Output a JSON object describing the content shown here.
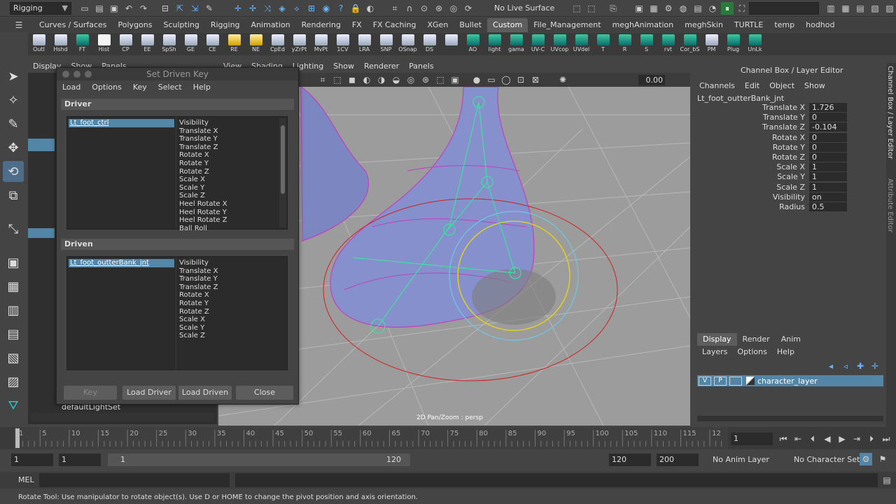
{
  "topbar": {
    "mode": "Rigging",
    "live_surface": "No Live Surface"
  },
  "shelf_tabs": [
    "Curves / Surfaces",
    "Polygons",
    "Sculpting",
    "Rigging",
    "Animation",
    "Rendering",
    "FX",
    "FX Caching",
    "XGen",
    "Bullet",
    "Custom",
    "File_Management",
    "meghAnimation",
    "meghSkin",
    "TURTLE",
    "temp",
    "hodhod"
  ],
  "shelf_active": "Custom",
  "shelf_items": [
    {
      "label": "Outl",
      "icon": "outliner-icon"
    },
    {
      "label": "Hshd",
      "icon": "hypershade-icon"
    },
    {
      "label": "FT",
      "icon": "freeze-transform-icon"
    },
    {
      "label": "Hist",
      "icon": "delete-history-icon"
    },
    {
      "label": "CP",
      "icon": "center-pivot-icon"
    },
    {
      "label": "EE",
      "icon": "editor-icon"
    },
    {
      "label": "SpSh",
      "icon": "spreadsheet-icon"
    },
    {
      "label": "GE",
      "icon": "graph-editor-icon"
    },
    {
      "label": "CE",
      "icon": "component-editor-icon"
    },
    {
      "label": "RE",
      "icon": "render-editor-icon"
    },
    {
      "label": "NE",
      "icon": "node-editor-icon"
    },
    {
      "label": "CpEd",
      "icon": "copy-edit-icon"
    },
    {
      "label": "yZrPt",
      "icon": "zero-pivot-icon"
    },
    {
      "label": "MvPt",
      "icon": "move-pivot-icon"
    },
    {
      "label": "1CV",
      "icon": "curve-icon"
    },
    {
      "label": "LRA",
      "icon": "local-axis-icon"
    },
    {
      "label": "SNP",
      "icon": "snap-icon"
    },
    {
      "label": "OSnap",
      "icon": "object-snap-icon"
    },
    {
      "label": "DS",
      "icon": "display-smooth-icon"
    },
    {
      "label": "",
      "icon": "grid-icon"
    },
    {
      "label": "AO",
      "icon": "ambient-occlusion-icon"
    },
    {
      "label": "light",
      "icon": "light-icon"
    },
    {
      "label": "gama",
      "icon": "gamma-icon"
    },
    {
      "label": "UV-C",
      "icon": "uv-copy-icon"
    },
    {
      "label": "UVcop",
      "icon": "uv-copy2-icon"
    },
    {
      "label": "UVdel",
      "icon": "uv-delete-icon"
    },
    {
      "label": "T",
      "icon": "translate-icon"
    },
    {
      "label": "R",
      "icon": "rotate-icon"
    },
    {
      "label": "S",
      "icon": "scale-icon"
    },
    {
      "label": "rvt",
      "icon": "revert-icon"
    },
    {
      "label": "Cor_bS",
      "icon": "corrective-blendshape-icon"
    },
    {
      "label": "PM",
      "icon": "pm-icon"
    },
    {
      "label": "Plug",
      "icon": "plugin-icon"
    },
    {
      "label": "UnLk",
      "icon": "unlock-icon"
    }
  ],
  "outliner": {
    "menu": [
      "Display",
      "Show",
      "Panels"
    ],
    "last_item": "defaultLightSet"
  },
  "viewport": {
    "menu": [
      "View",
      "Shading",
      "Lighting",
      "Show",
      "Renderer",
      "Panels"
    ],
    "zoom": "0.00",
    "status": "2D Pan/Zoom : persp"
  },
  "sdk": {
    "title": "Set Driven Key",
    "menu": [
      "Load",
      "Options",
      "Key",
      "Select",
      "Help"
    ],
    "driver_label": "Driver",
    "driver_object": "Lt_foot_ctrl",
    "driver_attrs": [
      "Visibility",
      "Translate X",
      "Translate Y",
      "Translate Z",
      "Rotate X",
      "Rotate Y",
      "Rotate Z",
      "Scale X",
      "Scale Y",
      "Scale Z",
      "Heel Rotate X",
      "Heel Rotate Y",
      "Heel Rotate Z",
      "Ball Roll"
    ],
    "driven_label": "Driven",
    "driven_object": "Lt_foot_outterBank_jnt",
    "driven_attrs": [
      "Visibility",
      "Translate X",
      "Translate Y",
      "Translate Z",
      "Rotate X",
      "Rotate Y",
      "Rotate Z",
      "Scale X",
      "Scale Y",
      "Scale Z"
    ],
    "buttons": {
      "key": "Key",
      "load_driver": "Load Driver",
      "load_driven": "Load Driven",
      "close": "Close"
    }
  },
  "channel_box": {
    "title": "Channel Box / Layer Editor",
    "menu": [
      "Channels",
      "Edit",
      "Object",
      "Show"
    ],
    "object": "Lt_foot_outterBank_jnt",
    "channels": [
      {
        "name": "Translate X",
        "value": "1.726"
      },
      {
        "name": "Translate Y",
        "value": "0"
      },
      {
        "name": "Translate Z",
        "value": "-0.104"
      },
      {
        "name": "Rotate X",
        "value": "0"
      },
      {
        "name": "Rotate Y",
        "value": "0"
      },
      {
        "name": "Rotate Z",
        "value": "0"
      },
      {
        "name": "Scale X",
        "value": "1"
      },
      {
        "name": "Scale Y",
        "value": "1"
      },
      {
        "name": "Scale Z",
        "value": "1"
      },
      {
        "name": "Visibility",
        "value": "on"
      },
      {
        "name": "Radius",
        "value": "0.5"
      }
    ]
  },
  "layer_editor": {
    "tabs": [
      "Display",
      "Render",
      "Anim"
    ],
    "menu": [
      "Layers",
      "Options",
      "Help"
    ],
    "layer": {
      "v": "V",
      "p": "P",
      "name": "character_layer"
    }
  },
  "side_tabs": [
    "Channel Box / Layer Editor",
    "Attribute Editor"
  ],
  "timeline": {
    "ticks": [
      "1",
      "5",
      "10",
      "15",
      "20",
      "25",
      "30",
      "35",
      "40",
      "45",
      "50",
      "55",
      "60",
      "65",
      "70",
      "75",
      "80",
      "85",
      "90",
      "95",
      "100",
      "105",
      "110",
      "115",
      "12"
    ],
    "current_frame": "1"
  },
  "range": {
    "start": "1",
    "playback_start": "1",
    "slider_start": "1",
    "slider_end": "120",
    "playback_end": "120",
    "end": "200",
    "anim_layer": "No Anim Layer",
    "char_set": "No Character Set"
  },
  "cmd": {
    "label": "MEL"
  },
  "help_line": "Rotate Tool: Use manipulator to rotate object(s). Use D or HOME to change the pivot position and axis orientation."
}
